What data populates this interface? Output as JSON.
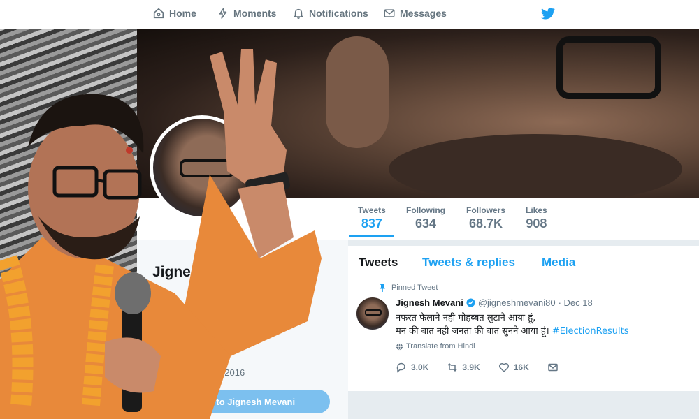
{
  "nav": {
    "home": "Home",
    "moments": "Moments",
    "notifications": "Notifications",
    "messages": "Messages"
  },
  "stats": [
    {
      "label": "Tweets",
      "value": "837"
    },
    {
      "label": "Following",
      "value": "634"
    },
    {
      "label": "Followers",
      "value": "68.7K"
    },
    {
      "label": "Likes",
      "value": "908"
    }
  ],
  "profile": {
    "name": "Jignesh Mevani",
    "joined": "Joined August 2016",
    "tweet_to_button": "Tweet to Jignesh Mevani"
  },
  "tabs": [
    "Tweets",
    "Tweets & replies",
    "Media"
  ],
  "tweet": {
    "pinned_label": "Pinned Tweet",
    "author": "Jignesh Mevani",
    "handle": "@jigneshmevani80",
    "date": "· Dec 18",
    "line1": "नफरत फैलाने नही मोहब्बत लुटाने आया हूं,",
    "line2": "मन की बात नही जनता की बात सुनने आया हूं।",
    "hashtag": "#ElectionResults",
    "translate": "Translate from Hindi",
    "replies": "3.0K",
    "retweets": "3.9K",
    "likes": "16K"
  },
  "colors": {
    "accent": "#1da1f2",
    "saffron": "#e8893a"
  }
}
